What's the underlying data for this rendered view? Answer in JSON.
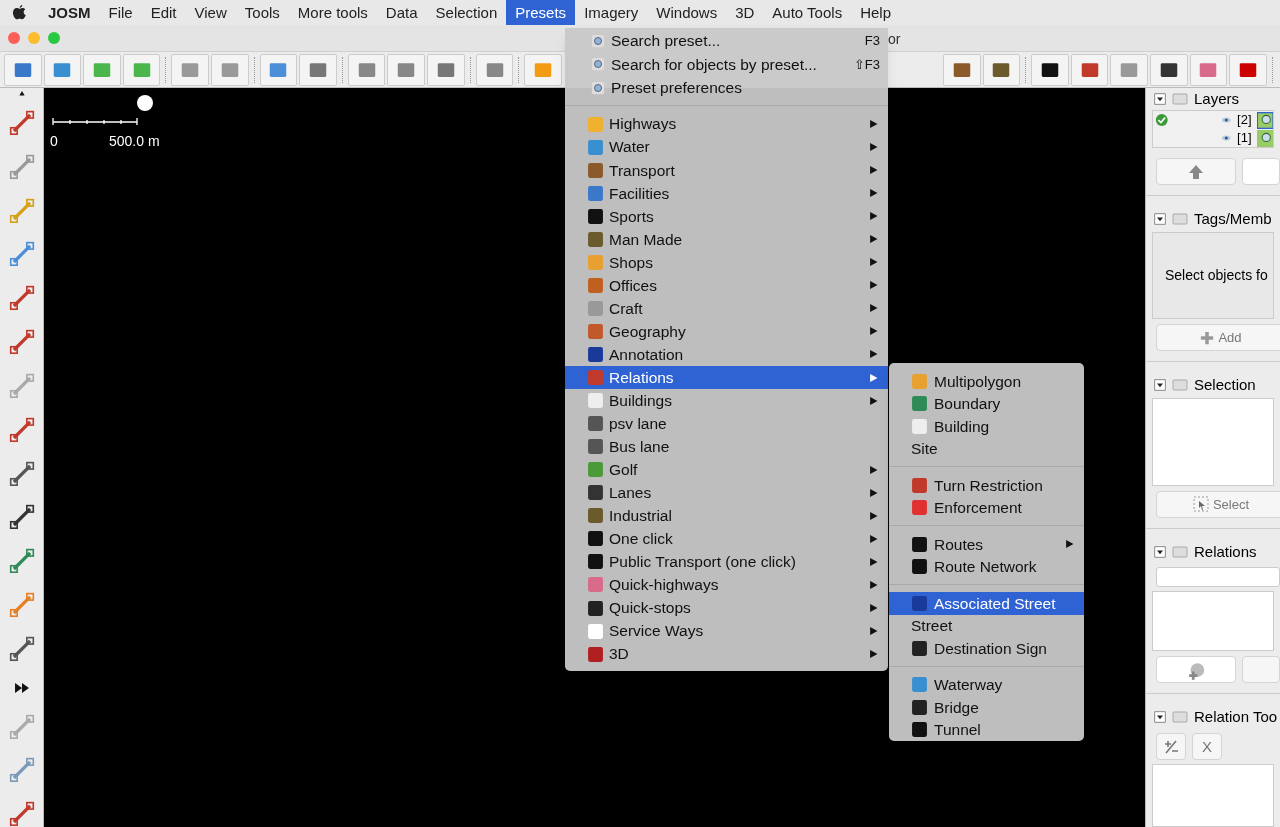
{
  "menu_bar": [
    {
      "label": "JOSM",
      "selected": false
    },
    {
      "label": "File",
      "selected": false
    },
    {
      "label": "Edit",
      "selected": false
    },
    {
      "label": "View",
      "selected": false
    },
    {
      "label": "Tools",
      "selected": false
    },
    {
      "label": "More tools",
      "selected": false
    },
    {
      "label": "Data",
      "selected": false
    },
    {
      "label": "Selection",
      "selected": false
    },
    {
      "label": "Presets",
      "selected": true
    },
    {
      "label": "Imagery",
      "selected": false
    },
    {
      "label": "Windows",
      "selected": false
    },
    {
      "label": "3D",
      "selected": false
    },
    {
      "label": "Auto Tools",
      "selected": false
    },
    {
      "label": "Help",
      "selected": false
    }
  ],
  "window": {
    "title": "or"
  },
  "map": {
    "scale_start": "0",
    "scale_end": "500.0 m"
  },
  "presets_menu": {
    "top_items": [
      {
        "label": "Search preset...",
        "shortcut": "F3"
      },
      {
        "label": "Search for objects by preset...",
        "shortcut": "⇧F3"
      },
      {
        "label": "Preset preferences"
      }
    ],
    "items": [
      {
        "label": "Highways",
        "submenu": true,
        "selected": false
      },
      {
        "label": "Water",
        "submenu": true,
        "selected": false
      },
      {
        "label": "Transport",
        "submenu": true,
        "selected": false
      },
      {
        "label": "Facilities",
        "submenu": true,
        "selected": false
      },
      {
        "label": "Sports",
        "submenu": true,
        "selected": false
      },
      {
        "label": "Man Made",
        "submenu": true,
        "selected": false
      },
      {
        "label": "Shops",
        "submenu": true,
        "selected": false
      },
      {
        "label": "Offices",
        "submenu": true,
        "selected": false
      },
      {
        "label": "Craft",
        "submenu": true,
        "selected": false
      },
      {
        "label": "Geography",
        "submenu": true,
        "selected": false
      },
      {
        "label": "Annotation",
        "submenu": true,
        "selected": false
      },
      {
        "label": "Relations",
        "submenu": true,
        "selected": true
      },
      {
        "label": "Buildings",
        "submenu": true,
        "selected": false
      },
      {
        "label": "psv lane",
        "submenu": false,
        "selected": false
      },
      {
        "label": "Bus lane",
        "submenu": false,
        "selected": false
      },
      {
        "label": "Golf",
        "submenu": true,
        "selected": false
      },
      {
        "label": "Lanes",
        "submenu": true,
        "selected": false
      },
      {
        "label": "Industrial",
        "submenu": true,
        "selected": false
      },
      {
        "label": "One click",
        "submenu": true,
        "selected": false
      },
      {
        "label": "Public Transport (one click)",
        "submenu": true,
        "selected": false
      },
      {
        "label": "Quick-highways",
        "submenu": true,
        "selected": false
      },
      {
        "label": "Quick-stops",
        "submenu": true,
        "selected": false
      },
      {
        "label": "Service Ways",
        "submenu": true,
        "selected": false
      },
      {
        "label": "3D",
        "submenu": true,
        "selected": false
      }
    ]
  },
  "relations_submenu": [
    [
      {
        "label": "Multipolygon",
        "has_icon": true,
        "submenu": false,
        "selected": false
      },
      {
        "label": "Boundary",
        "has_icon": true,
        "submenu": false,
        "selected": false
      },
      {
        "label": "Building",
        "has_icon": true,
        "submenu": false,
        "selected": false
      },
      {
        "label": "Site",
        "has_icon": false,
        "submenu": false,
        "selected": false
      }
    ],
    [
      {
        "label": "Turn Restriction",
        "has_icon": true,
        "submenu": false,
        "selected": false
      },
      {
        "label": "Enforcement",
        "has_icon": true,
        "submenu": false,
        "selected": false
      }
    ],
    [
      {
        "label": "Routes",
        "has_icon": true,
        "submenu": true,
        "selected": false
      },
      {
        "label": "Route Network",
        "has_icon": true,
        "submenu": false,
        "selected": false
      }
    ],
    [
      {
        "label": "Associated Street",
        "has_icon": true,
        "submenu": false,
        "selected": true
      },
      {
        "label": "Street",
        "has_icon": false,
        "submenu": false,
        "selected": false
      },
      {
        "label": "Destination Sign",
        "has_icon": true,
        "submenu": false,
        "selected": false
      }
    ],
    [
      {
        "label": "Waterway",
        "has_icon": true,
        "submenu": false,
        "selected": false
      },
      {
        "label": "Bridge",
        "has_icon": true,
        "submenu": false,
        "selected": false
      },
      {
        "label": "Tunnel",
        "has_icon": true,
        "submenu": false,
        "selected": false
      }
    ]
  ],
  "panels": {
    "layers": {
      "title": "Layers",
      "rows": [
        {
          "label": "[2]",
          "active": true
        },
        {
          "label": "[1]",
          "active": false
        }
      ]
    },
    "tags": {
      "title": "Tags/Memb",
      "message": "Select objects fo",
      "add_button": "Add"
    },
    "selection": {
      "title": "Selection",
      "select_button": "Select"
    },
    "relations": {
      "title": "Relations"
    },
    "relation_toolbox": {
      "title": "Relation Too",
      "button": "X"
    }
  }
}
